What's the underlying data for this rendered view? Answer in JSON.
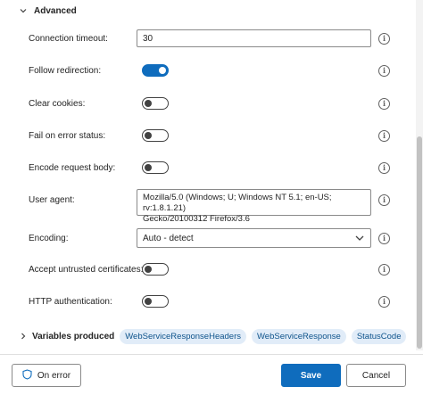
{
  "advanced": {
    "title": "Advanced"
  },
  "fields": {
    "connection_timeout": {
      "label": "Connection timeout:",
      "value": "30"
    },
    "follow_redirection": {
      "label": "Follow redirection:",
      "on": true
    },
    "clear_cookies": {
      "label": "Clear cookies:",
      "on": false
    },
    "fail_on_error": {
      "label": "Fail on error status:",
      "on": false
    },
    "encode_request_body": {
      "label": "Encode request body:",
      "on": false
    },
    "user_agent": {
      "label": "User agent:",
      "value": "Mozilla/5.0 (Windows; U; Windows NT 5.1; en-US; rv:1.8.1.21)\nGecko/20100312 Firefox/3.6"
    },
    "encoding": {
      "label": "Encoding:",
      "value": "Auto - detect"
    },
    "accept_untrusted": {
      "label": "Accept untrusted certificates:",
      "on": false
    },
    "http_auth": {
      "label": "HTTP authentication:",
      "on": false
    }
  },
  "variables": {
    "title": "Variables produced",
    "chips": [
      "WebServiceResponseHeaders",
      "WebServiceResponse",
      "StatusCode"
    ]
  },
  "footer": {
    "on_error": "On error",
    "save": "Save",
    "cancel": "Cancel"
  },
  "colors": {
    "accent": "#0f6cbd",
    "chip_bg": "#e1ecf8",
    "chip_text": "#0f548c"
  }
}
